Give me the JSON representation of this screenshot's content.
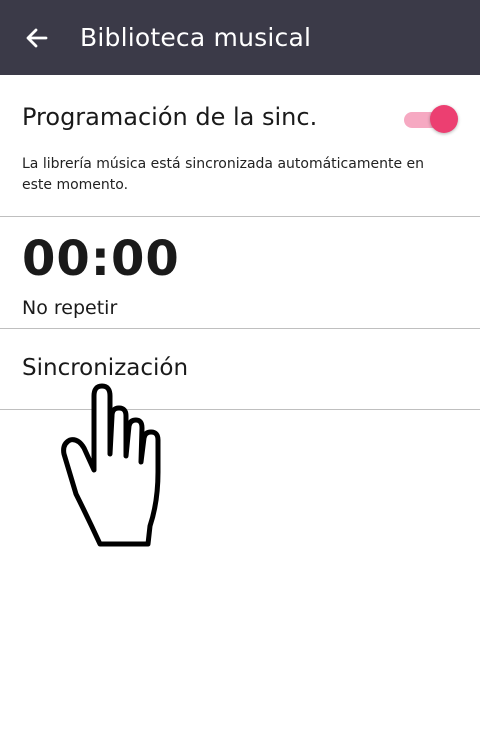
{
  "app_bar": {
    "title": "Biblioteca musical",
    "back_icon": "arrow-left-icon"
  },
  "sync_schedule": {
    "title": "Programación de la sinc.",
    "description": "La librería música está sincronizada automáticamente en este momento.",
    "toggle_on": true,
    "accent_color": "#ec3f71"
  },
  "time_setting": {
    "time": "00:00",
    "repeat": "No repetir"
  },
  "sync": {
    "label": "Sincronización"
  },
  "overlay": {
    "icon": "pointing-hand-icon"
  },
  "colors": {
    "app_bar": "#3b3a48",
    "divider": "#bfbfbf"
  }
}
